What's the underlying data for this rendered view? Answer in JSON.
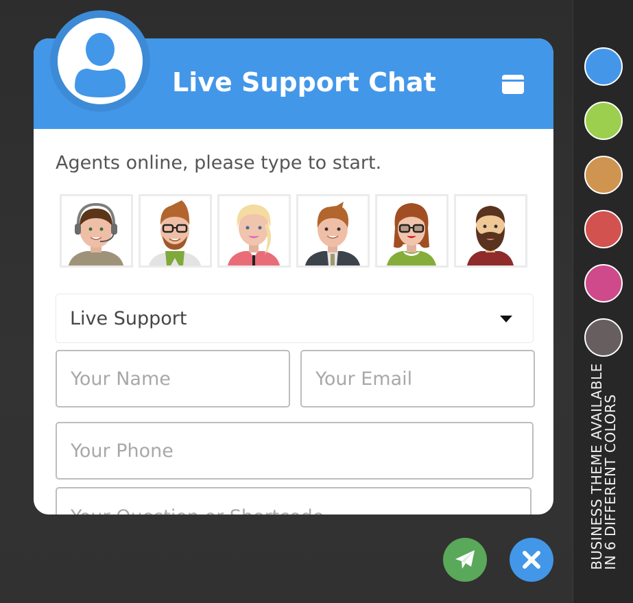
{
  "header": {
    "title": "Live Support Chat",
    "avatar_icon": "user-icon",
    "minimize_icon": "window-minimize-icon",
    "color": "#4397e8"
  },
  "body": {
    "status_text": "Agents online, please type to start.",
    "agents": [
      {
        "name": "agent-headset-man",
        "description": "Man with headset"
      },
      {
        "name": "agent-glasses-bearded-man",
        "description": "Bearded man with glasses and green scarf"
      },
      {
        "name": "agent-blonde-woman",
        "description": "Blonde woman"
      },
      {
        "name": "agent-suit-man",
        "description": "Man in suit"
      },
      {
        "name": "agent-glasses-woman",
        "description": "Woman with glasses"
      },
      {
        "name": "agent-bearded-man",
        "description": "Man with full beard"
      }
    ],
    "department_select": {
      "selected": "Live Support"
    },
    "name_field": {
      "placeholder": "Your Name",
      "value": ""
    },
    "email_field": {
      "placeholder": "Your Email",
      "value": ""
    },
    "phone_field": {
      "placeholder": "Your Phone",
      "value": ""
    },
    "question_field": {
      "placeholder": "Your Question or Shortcode",
      "value": ""
    }
  },
  "actions": {
    "send": {
      "icon": "paper-plane-icon",
      "color": "#5aa85a"
    },
    "close": {
      "icon": "close-icon",
      "color": "#4397e8"
    }
  },
  "theme_picker": {
    "colors": [
      "#4497e8",
      "#9ccf4e",
      "#cf9450",
      "#d2524f",
      "#cf4a8b",
      "#675f5f"
    ],
    "promo_line1": "BUSINESS THEME AVAILABLE",
    "promo_line2": "IN 6 DIFFERENT COLORS"
  }
}
